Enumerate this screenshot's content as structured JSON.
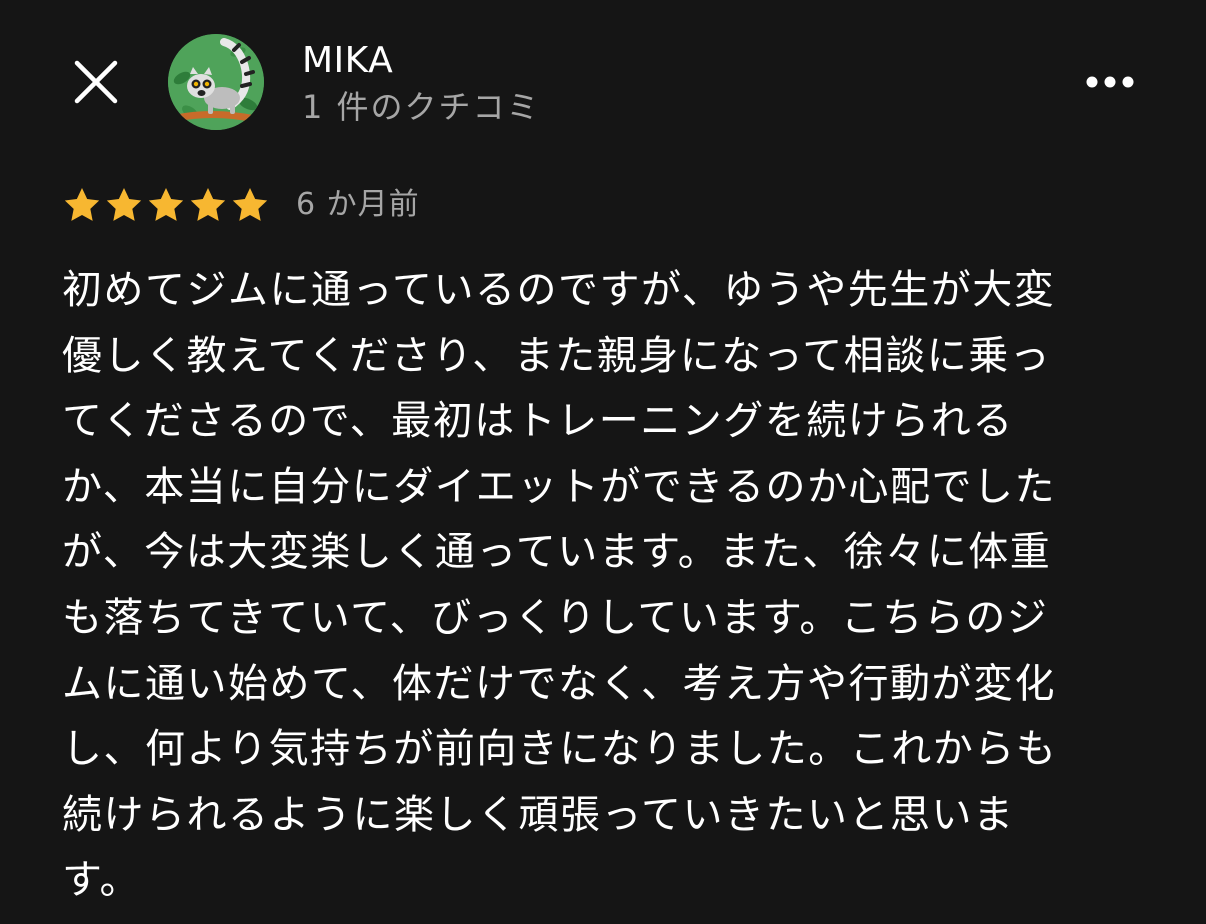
{
  "header": {
    "close_icon": "close-icon",
    "avatar_icon": "lemur-avatar",
    "user_name": "MIKA",
    "review_count": "1 件のクチコミ",
    "more_icon": "more-horizontal-icon"
  },
  "review": {
    "rating": 5,
    "rating_max": 5,
    "star_color": "#f7b731",
    "date": "6 か月前",
    "text": "初めてジムに通っているのですが、ゆうや先生が大変\n優しく教えてくださり、また親身になって相談に乗っ\nてくださるので、最初はトレーニングを続けられる\nか、本当に自分にダイエットができるのか心配でした\nが、今は大変楽しく通っています。また、徐々に体重\nも落ちてきていて、びっくりしています。こちらのジ\nムに通い始めて、体だけでなく、考え方や行動が変化\nし、何より気持ちが前向きになりました。これからも\n続けられるように楽しく頑張っていきたいと思いま\nす。"
  },
  "colors": {
    "background": "#151515",
    "primary_text": "#ffffff",
    "secondary_text": "#a6a6a6"
  }
}
